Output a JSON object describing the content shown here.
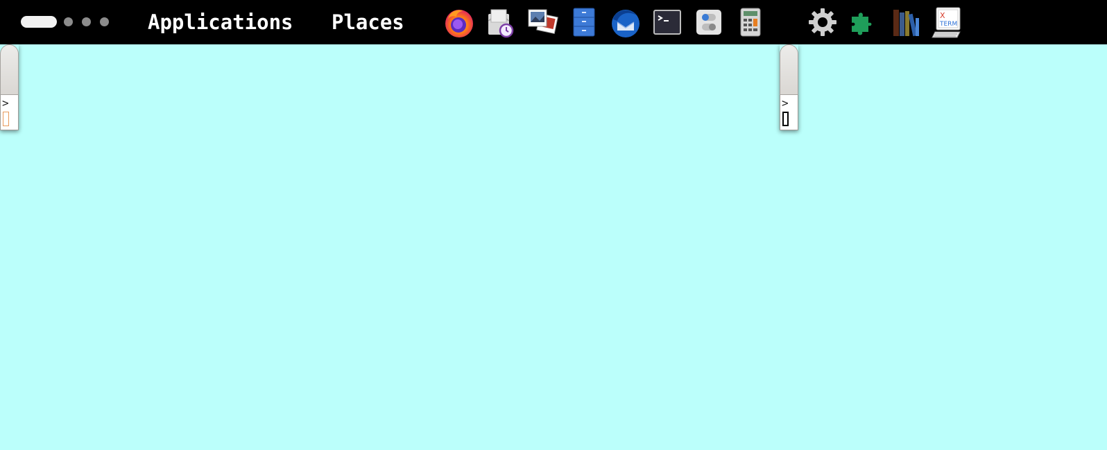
{
  "topbar": {
    "workspaces": {
      "active_index": 0,
      "count": 4
    },
    "menu": {
      "applications_label": "Applications",
      "places_label": "Places"
    },
    "launchers": [
      {
        "icon": "firefox-icon"
      },
      {
        "icon": "mail-scheduler-icon"
      },
      {
        "icon": "image-viewer-icon"
      },
      {
        "icon": "file-cabinet-icon"
      },
      {
        "icon": "thunderbird-icon"
      },
      {
        "icon": "terminal-icon"
      },
      {
        "icon": "tweaks-toggle-icon"
      },
      {
        "icon": "calculator-icon"
      },
      {
        "icon": "settings-gear-icon"
      },
      {
        "icon": "extensions-puzzle-icon"
      },
      {
        "icon": "calibre-books-icon"
      },
      {
        "icon": "xterm-icon"
      }
    ],
    "xterm_icon_text_top": "X",
    "xterm_icon_text_bottom": "TERM"
  },
  "desktop": {
    "background_color": "#bbfffb",
    "terminals": [
      {
        "prompt": ">",
        "cursor_color": "#e89a5c",
        "focused": false
      },
      {
        "prompt": ">",
        "cursor_color": "#000000",
        "focused": true
      }
    ]
  }
}
